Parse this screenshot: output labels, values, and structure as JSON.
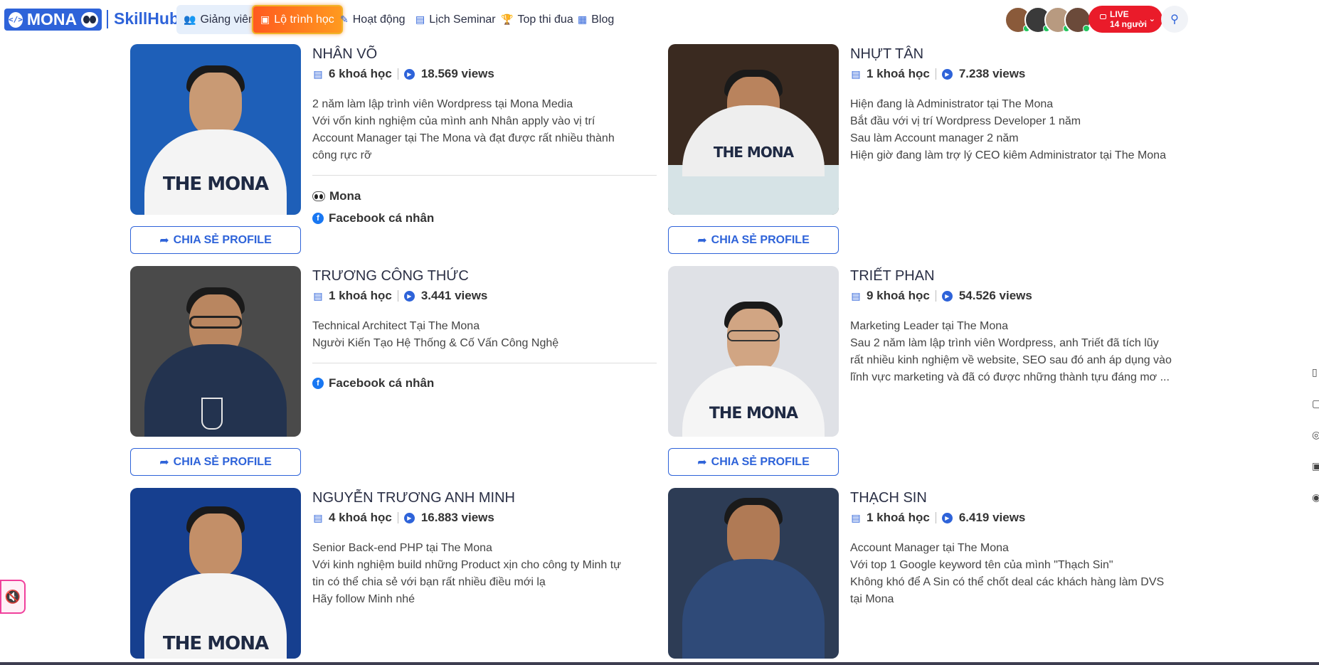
{
  "header": {
    "logo_text": "MONA",
    "brand_text": "SkillHub",
    "nav": [
      {
        "label": "Giảng viên",
        "icon": "users-icon"
      },
      {
        "label": "Lộ trình học",
        "icon": "route-icon"
      },
      {
        "label": "Hoạt động",
        "icon": "megaphone-icon"
      },
      {
        "label": "Lịch Seminar",
        "icon": "calendar-icon"
      },
      {
        "label": "Top thi đua",
        "icon": "trophy-icon"
      },
      {
        "label": "Blog",
        "icon": "blog-icon"
      }
    ],
    "live": {
      "label": "LIVE",
      "viewers": "14 người"
    }
  },
  "share_label": "CHIA SẺ PROFILE",
  "instructors": [
    {
      "name": "NHÂN VÕ",
      "courses": "6 khoá học",
      "views": "18.569 views",
      "bio": [
        "2 năm làm lập trình viên Wordpress tại Mona Media",
        "Với vốn kinh nghiệm của mình anh Nhân apply vào vị trí",
        "Account Manager tại The Mona và đạt được rất nhiều thành",
        "công rực rỡ"
      ],
      "links": [
        "Mona",
        "Facebook cá nhân"
      ],
      "photo_bg": "#1e5fb8",
      "shirt": "#f4f4f4"
    },
    {
      "name": "NHỰT TÂN",
      "courses": "1 khoá học",
      "views": "7.238 views",
      "bio": [
        "Hiện đang là Administrator tại The Mona",
        "Bắt đầu với vị trí Wordpress Developer 1 năm",
        "Sau làm Account manager 2 năm",
        "Hiện giờ đang làm trợ lý CEO kiêm Administrator tại The Mona"
      ],
      "links": [],
      "photo_bg": "#3a2a20",
      "shirt": "#eeeeee"
    },
    {
      "name": "TRƯƠNG CÔNG THỨC",
      "courses": "1 khoá học",
      "views": "3.441 views",
      "bio": [
        "Technical Architect Tại The Mona",
        "Người Kiến Tạo Hệ Thống & Cố Vấn Công Nghệ"
      ],
      "links": [
        "Facebook cá nhân"
      ],
      "photo_bg": "#4a4a4a",
      "shirt": "#23334f"
    },
    {
      "name": "TRIẾT PHAN",
      "courses": "9 khoá học",
      "views": "54.526 views",
      "bio": [
        "Marketing Leader tại The Mona",
        "Sau 2 năm làm lập trình viên Wordpress, anh Triết đã tích lũy",
        "rất nhiều kinh nghiệm về website, SEO sau đó anh áp dụng vào",
        "lĩnh vực marketing và đã có được những thành tựu đáng mơ ..."
      ],
      "links": [],
      "photo_bg": "#dfe1e6",
      "shirt": "#f5f5f5"
    },
    {
      "name": "NGUYỄN TRƯƠNG ANH MINH",
      "courses": "4 khoá học",
      "views": "16.883 views",
      "bio": [
        "Senior Back-end PHP tại The Mona",
        "Với kinh nghiệm build những Product xịn cho công ty Minh tự",
        "tin có thể chia sẻ với bạn rất nhiều điều mới lạ",
        "Hãy follow Minh nhé"
      ],
      "links": [],
      "photo_bg": "#163f8f",
      "shirt": "#f4f4f4"
    },
    {
      "name": "THẠCH SIN",
      "courses": "1 khoá học",
      "views": "6.419 views",
      "bio": [
        "Account Manager tại The Mona",
        "Với top 1 Google keyword tên của mình \"Thạch Sin\"",
        "Không khó để A Sin có thể chốt deal các khách hàng làm DVS",
        "tại Mona"
      ],
      "links": [],
      "photo_bg": "#2d3c55",
      "shirt": "#2f4a78"
    }
  ],
  "photo_brand_text": "THE MONA"
}
